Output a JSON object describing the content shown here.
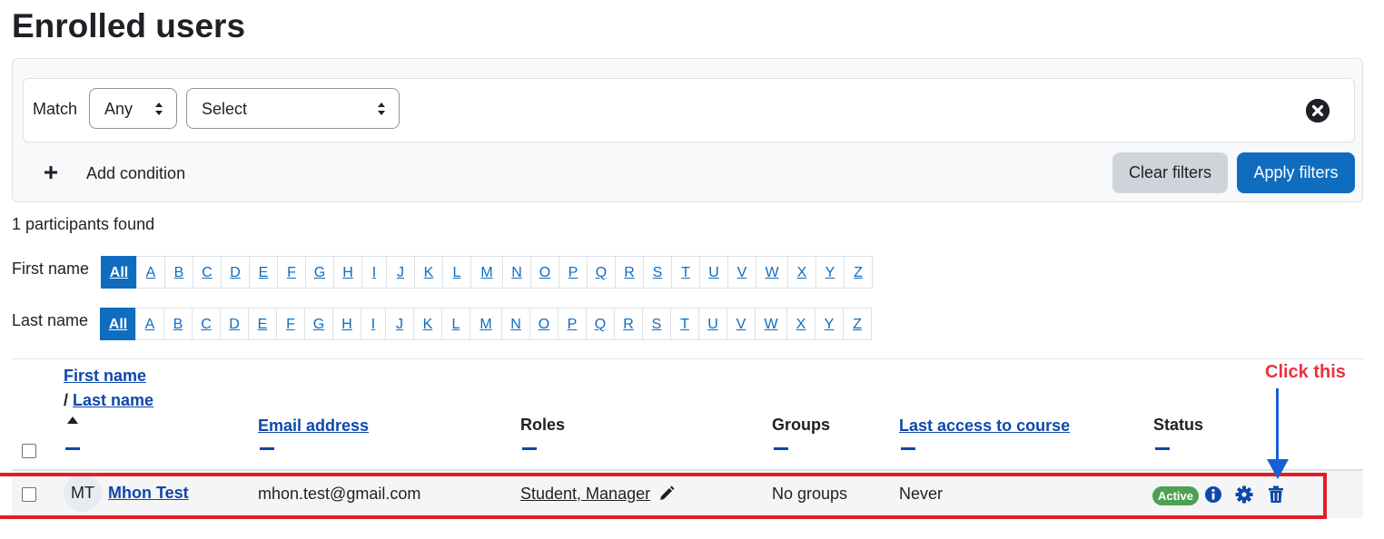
{
  "page": {
    "title": "Enrolled users"
  },
  "filters": {
    "match_label": "Match",
    "match_value": "Any",
    "condition_select": "Select",
    "add_condition": "Add condition",
    "add_icon": "plus-icon",
    "remove_icon": "close-circle-icon",
    "clear_label": "Clear filters",
    "apply_label": "Apply filters"
  },
  "results": {
    "count_text": "1 participants found"
  },
  "initials": {
    "first_label": "First name",
    "last_label": "Last name",
    "all_label": "All",
    "letters": [
      "A",
      "B",
      "C",
      "D",
      "E",
      "F",
      "G",
      "H",
      "I",
      "J",
      "K",
      "L",
      "M",
      "N",
      "O",
      "P",
      "Q",
      "R",
      "S",
      "T",
      "U",
      "V",
      "W",
      "X",
      "Y",
      "Z"
    ]
  },
  "table": {
    "headers": {
      "first_name": "First name",
      "slash": "/",
      "last_name": "Last name",
      "email": "Email address",
      "roles": "Roles",
      "groups": "Groups",
      "last_access": "Last access to course",
      "status": "Status"
    },
    "rows": [
      {
        "initials": "MT",
        "name": "Mhon Test",
        "email": "mhon.test@gmail.com",
        "roles": "Student, Manager",
        "groups": "No groups",
        "last_access": "Never",
        "status": "Active"
      }
    ]
  },
  "annotation": {
    "text": "Click this"
  },
  "colors": {
    "primary": "#0f6cbf",
    "link": "#0f47ad",
    "active_badge": "#4ea152",
    "highlight_box": "#e11d27",
    "annotation_text": "#e8323f",
    "annotation_arrow": "#1a5ed6"
  }
}
